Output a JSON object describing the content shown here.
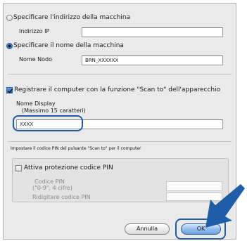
{
  "connection": {
    "ip_option_label": "Specificare l'indirizzo della macchina",
    "ip_field_label": "Indirizzo IP",
    "ip_field_value": "",
    "node_option_label": "Specificare il nome della macchina",
    "node_field_label": "Nome Nodo",
    "node_field_value": "BRN_XXXXXX",
    "selected": "node"
  },
  "scan_to": {
    "checkbox_label": "Registrare il computer con la funzione \"Scan to\" dell'apparecchio",
    "checked": true,
    "display_name_label": "Nome Display",
    "display_name_hint": "(Massimo 15 caratteri)",
    "display_name_value": "XXXX"
  },
  "pin": {
    "section_label": "Impostare il codice PIN del pulsante \"Scan to\" per il computer",
    "enable_label": "Attiva protezione codice PIN",
    "enabled": false,
    "code_label": "Codice PIN",
    "code_hint": "(\"0-9\", 4 cifre)",
    "code_value": "",
    "confirm_label": "Ridigitare codice PIN",
    "confirm_value": ""
  },
  "buttons": {
    "cancel_label": "Annulla",
    "ok_label": "OK"
  },
  "colors": {
    "highlight": "#1f5da8",
    "arrow": "#1f5da8",
    "default_button": "#6da3e0"
  },
  "icons": {
    "pointer_arrow": "arrow-icon"
  }
}
